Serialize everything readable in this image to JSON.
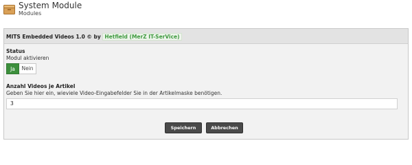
{
  "header": {
    "title": "System Module",
    "subtitle": "Modules"
  },
  "panel": {
    "heading_prefix": "MITS Embedded Videos 1.0 © by ",
    "author_link": "Hetfield (MerZ IT-SerVice)"
  },
  "status": {
    "label": "Status",
    "sublabel": "Modul aktivieren",
    "options": [
      "Ja",
      "Nein"
    ],
    "selected": "Ja"
  },
  "videos": {
    "label": "Anzahl Videos je Artikel",
    "description": "Geben Sie hier ein, wieviele Video-Eingabefelder Sie in der Artikelmaske benötigen.",
    "value": "3"
  },
  "buttons": {
    "save": "Speichern",
    "cancel": "Abbrechen"
  },
  "colors": {
    "toggle_on": "#3c8f3c",
    "link": "#3f9a3f",
    "button_bg": "#4a4a4a"
  }
}
